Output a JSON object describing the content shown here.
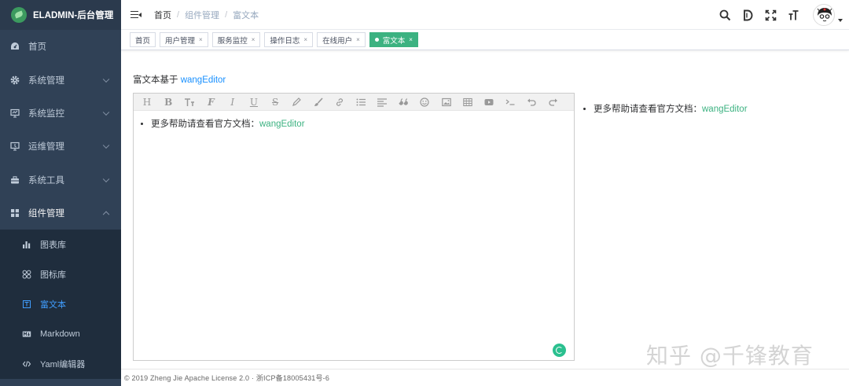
{
  "brand": {
    "title": "ELADMIN-后台管理"
  },
  "sidebar": {
    "items": [
      {
        "label": "首页",
        "icon": "dashboard-icon"
      },
      {
        "label": "系统管理",
        "icon": "gear-icon"
      },
      {
        "label": "系统监控",
        "icon": "monitor-icon"
      },
      {
        "label": "运维管理",
        "icon": "ops-monitor-icon"
      },
      {
        "label": "系统工具",
        "icon": "toolbox-icon"
      },
      {
        "label": "组件管理",
        "icon": "grid-icon"
      }
    ],
    "submenu": [
      {
        "label": "图表库",
        "icon": "bar-chart-icon"
      },
      {
        "label": "图标库",
        "icon": "icons-icon"
      },
      {
        "label": "富文本",
        "icon": "richtext-icon"
      },
      {
        "label": "Markdown",
        "icon": "markdown-icon"
      },
      {
        "label": "Yaml编辑器",
        "icon": "code-icon"
      }
    ]
  },
  "breadcrumb": {
    "home": "首页",
    "parent": "组件管理",
    "current": "富文本",
    "separator": "/"
  },
  "tags": [
    {
      "label": "首页"
    },
    {
      "label": "用户管理"
    },
    {
      "label": "服务监控"
    },
    {
      "label": "操作日志"
    },
    {
      "label": "在线用户"
    },
    {
      "label": "富文本"
    }
  ],
  "tag_close": "×",
  "page": {
    "heading_prefix": "富文本基于",
    "heading_link": "wangEditor",
    "editor_item_prefix": "更多帮助请查看官方文档：",
    "editor_item_link": "wangEditor",
    "preview_item_prefix": "更多帮助请查看官方文档：",
    "preview_item_link": "wangEditor"
  },
  "watermark": "知乎 @千锋教育",
  "footer": {
    "text": "© 2019 Zheng Jie Apache License 2.0 · 浙ICP备18005431号-6"
  },
  "colors": {
    "sidebar_bg": "#304156",
    "accent_green": "#3cb281",
    "link_blue": "#1890ff",
    "active_blue": "#409eff"
  }
}
